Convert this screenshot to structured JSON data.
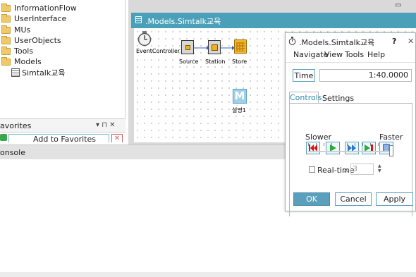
{
  "tree": {
    "items": [
      {
        "label": "InformationFlow"
      },
      {
        "label": "UserInterface"
      },
      {
        "label": "MUs"
      },
      {
        "label": "UserObjects"
      },
      {
        "label": "Tools"
      },
      {
        "label": "Models"
      },
      {
        "label": "Simtalk교육"
      }
    ]
  },
  "favorites": {
    "title": "avorites",
    "pin_glyph": "▾ ⊓ ✕",
    "add_label": "Add to Favorites"
  },
  "console": {
    "title": "onsole"
  },
  "frame": {
    "title": ".Models.Simtalk교육",
    "objects": {
      "event_controller": "EventController",
      "source": "Source",
      "station": "Station",
      "store": "Store",
      "method_letter": "M",
      "method_label": "설명1"
    }
  },
  "dialog": {
    "title": ".Models.Simtalk교육",
    "help": "?",
    "close": "✕",
    "menu": [
      "Navigate",
      "View",
      "Tools",
      "Help"
    ],
    "time_label": "Time",
    "time_value": "1:40.0000",
    "tabs": [
      "Controls",
      "Settings"
    ],
    "slower": "Slower",
    "faster": "Faster",
    "realtime_label": "Real-time",
    "realtime_x": "×",
    "realtime_value": "3",
    "ok": "OK",
    "cancel": "Cancel",
    "apply": "Apply"
  },
  "colors": {
    "title_bar": "#4aa0b8",
    "accent": "#2e8bb0",
    "ok_button": "#5aa0bc"
  }
}
